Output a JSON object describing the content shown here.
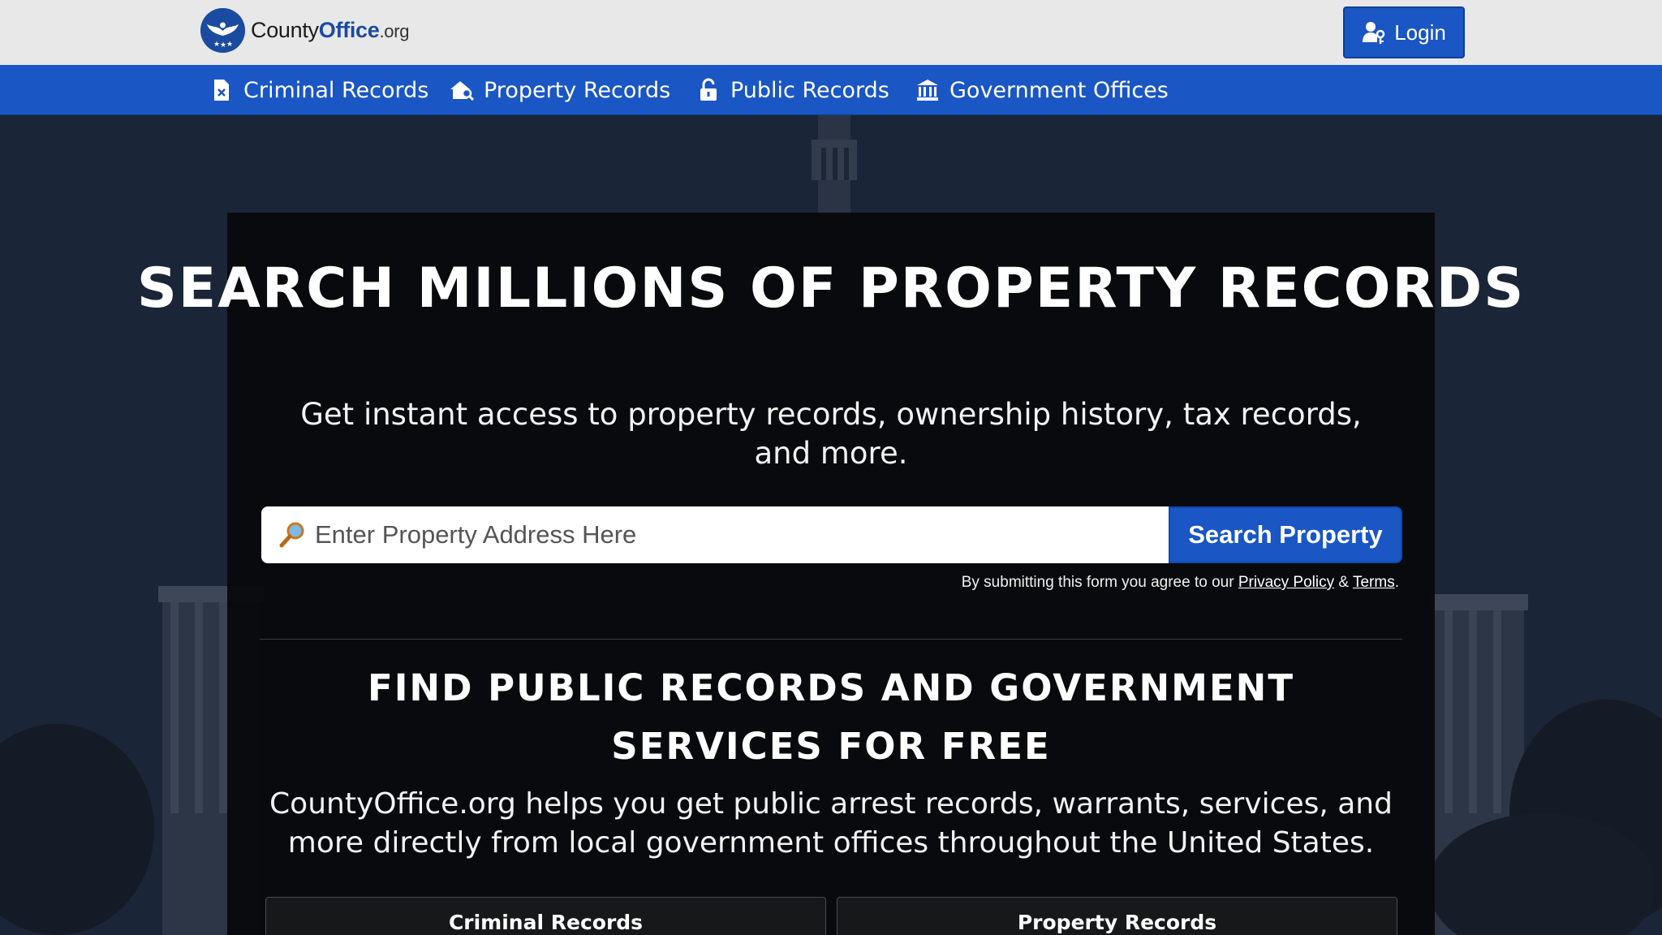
{
  "header": {
    "logo": {
      "brand_plain": "County",
      "brand_bold": "Office",
      "brand_tld": ".org"
    },
    "login_label": "Login"
  },
  "nav": {
    "items": [
      {
        "label": "Criminal Records",
        "icon": "file-x-icon"
      },
      {
        "label": "Property Records",
        "icon": "house-search-icon"
      },
      {
        "label": "Public Records",
        "icon": "unlock-icon"
      },
      {
        "label": "Government Offices",
        "icon": "government-building-icon"
      }
    ]
  },
  "hero": {
    "title": "SEARCH MILLIONS OF PROPERTY RECORDS",
    "subtitle": "Get instant access to property records, ownership history, tax records, and more.",
    "search": {
      "placeholder": "Enter Property Address Here",
      "button_label": "Search Property"
    },
    "disclaimer": {
      "prefix": "By submitting this form you agree to our ",
      "privacy_label": "Privacy Policy",
      "separator": " & ",
      "terms_label": "Terms",
      "suffix": "."
    }
  },
  "section": {
    "title": "FIND PUBLIC RECORDS AND GOVERNMENT SERVICES FOR FREE",
    "description": "CountyOffice.org helps you get public arrest records, warrants, services, and more directly from local government offices throughout the United States.",
    "cards": [
      {
        "label": "Criminal Records"
      },
      {
        "label": "Property Records"
      }
    ]
  },
  "colors": {
    "primary_blue": "#1a56c4",
    "header_bg": "#e8e8e8",
    "panel_bg": "#08090b"
  }
}
